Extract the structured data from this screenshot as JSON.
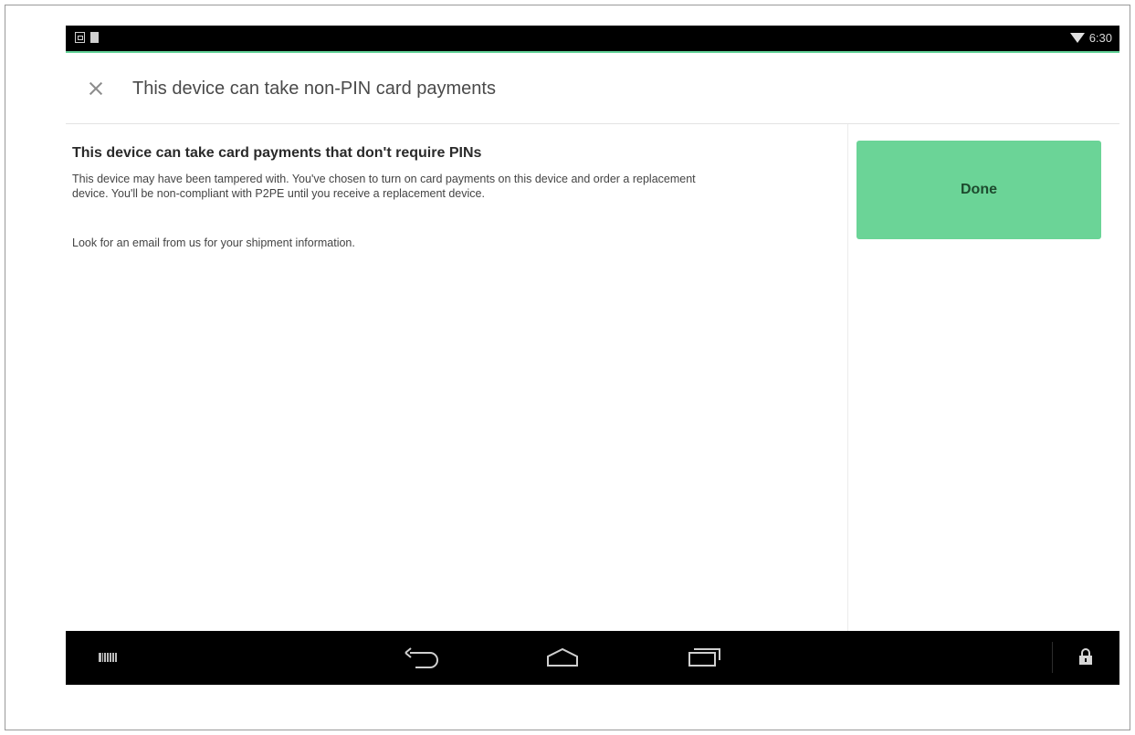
{
  "status_bar": {
    "time": "6:30"
  },
  "header": {
    "title": "This device can take non-PIN card payments"
  },
  "content": {
    "heading": "This device can take card payments that don't require PINs",
    "paragraph1": "This device may have been tampered with. You've chosen to turn on card payments on this device and order a replacement device. You'll be non-compliant with P2PE until you receive a replacement device.",
    "paragraph2": "Look for an email from us for your shipment information."
  },
  "side_panel": {
    "done_label": "Done"
  },
  "colors": {
    "accent": "#6bd497",
    "status_accent": "#63d298"
  },
  "icons": [
    "close-icon",
    "wifi-icon",
    "barcode-icon",
    "back-icon",
    "home-icon",
    "recent-apps-icon",
    "lock-icon"
  ]
}
